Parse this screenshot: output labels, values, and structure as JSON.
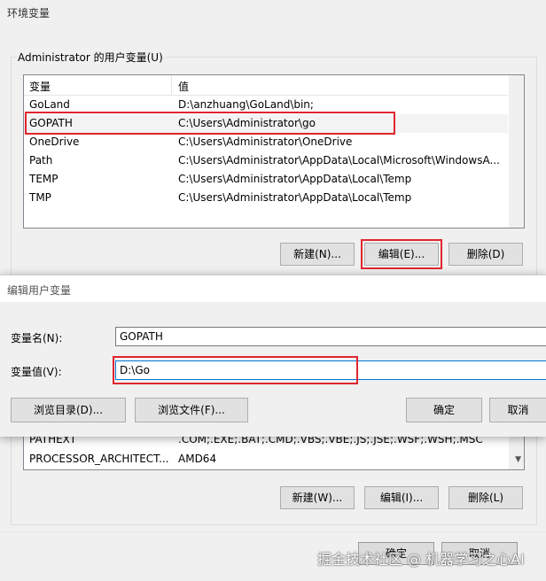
{
  "env_window": {
    "title": "环境变量",
    "user_group_label": "Administrator 的用户变量(U)",
    "columns": {
      "name": "变量",
      "value": "值"
    },
    "user_vars": [
      {
        "name": "GoLand",
        "value": "D:\\anzhuang\\GoLand\\bin;"
      },
      {
        "name": "GOPATH",
        "value": "C:\\Users\\Administrator\\go"
      },
      {
        "name": "OneDrive",
        "value": "C:\\Users\\Administrator\\OneDrive"
      },
      {
        "name": "Path",
        "value": "C:\\Users\\Administrator\\AppData\\Local\\Microsoft\\WindowsA..."
      },
      {
        "name": "TEMP",
        "value": "C:\\Users\\Administrator\\AppData\\Local\\Temp"
      },
      {
        "name": "TMP",
        "value": "C:\\Users\\Administrator\\AppData\\Local\\Temp"
      }
    ],
    "user_buttons": {
      "new": "新建(N)...",
      "edit": "编辑(E)...",
      "delete": "删除(D)"
    },
    "sys_vars": [
      {
        "name": "PATHEXT",
        "value": ".COM;.EXE;.BAT;.CMD;.VBS;.VBE;.JS;.JSE;.WSF;.WSH;.MSC"
      },
      {
        "name": "PROCESSOR_ARCHITECT...",
        "value": "AMD64"
      }
    ],
    "sys_buttons": {
      "new": "新建(W)...",
      "edit": "编辑(I)...",
      "delete": "删除(L)"
    },
    "ok": "确定",
    "cancel": "取消"
  },
  "edit_dialog": {
    "title": "编辑用户变量",
    "name_label": "变量名(N):",
    "name_value": "GOPATH",
    "value_label": "变量值(V):",
    "value_value": "D:\\Go",
    "browse_dir": "浏览目录(D)...",
    "browse_file": "浏览文件(F)...",
    "ok": "确定",
    "cancel": "取消"
  },
  "watermark": "掘金技术社区 @ 机器学习之心AI",
  "colors": {
    "highlight_red": "#e0262f",
    "focus_blue": "#0078d7"
  }
}
